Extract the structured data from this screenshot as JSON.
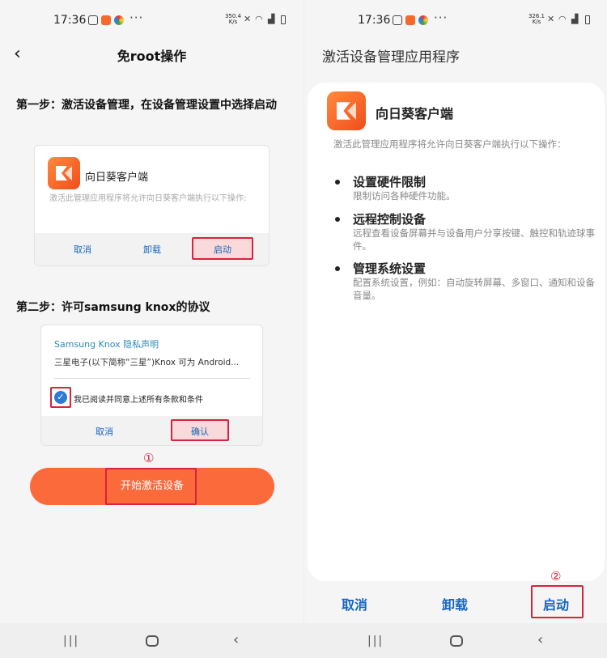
{
  "left": {
    "status": {
      "time": "17:36",
      "speed": "350.4\nK/s",
      "more": "···"
    },
    "title": "免root操作",
    "step1": {
      "title": "第一步：激活设备管理，在设备管理设置中选择启动",
      "card": {
        "app_name": "向日葵客户端",
        "desc": "激活此管理应用程序将允许向日葵客户端执行以下操作:",
        "buttons": [
          "取消",
          "卸载",
          "启动"
        ]
      }
    },
    "step2": {
      "title": "第二步：许可samsung knox的协议",
      "card": {
        "title": "Samsung Knox 隐私声明",
        "body": "三星电子(以下简称“三星”)Knox 可为 Android...",
        "checkbox_label": "我已阅读并同意上述所有条款和条件",
        "buttons": [
          "取消",
          "确认"
        ]
      }
    },
    "marker": "①",
    "primary_button": "开始激活设备"
  },
  "right": {
    "status": {
      "time": "17:36",
      "speed": "326.1\nK/s",
      "more": "···"
    },
    "header": "激活设备管理应用程序",
    "app_name": "向日葵客户端",
    "desc": "激活此管理应用程序将允许向日葵客户端执行以下操作：",
    "permissions": [
      {
        "title": "设置硬件限制",
        "desc": "限制访问各种硬件功能。"
      },
      {
        "title": "远程控制设备",
        "desc": "远程查看设备屏幕并与设备用户分享按键、触控和轨迹球事件。"
      },
      {
        "title": "管理系统设置",
        "desc": "配置系统设置，例如：自动旋转屏幕、多窗口、通知和设备音量。"
      }
    ],
    "buttons": {
      "cancel": "取消",
      "uninstall": "卸载",
      "activate": "启动"
    },
    "marker": "②"
  },
  "colors": {
    "accent": "#fb6a3b",
    "highlight": "#d6243a",
    "link": "#1565c0"
  },
  "icons": [
    "back-icon",
    "app-icon",
    "check-icon",
    "nav-recent-icon",
    "nav-home-icon",
    "nav-back-icon"
  ]
}
